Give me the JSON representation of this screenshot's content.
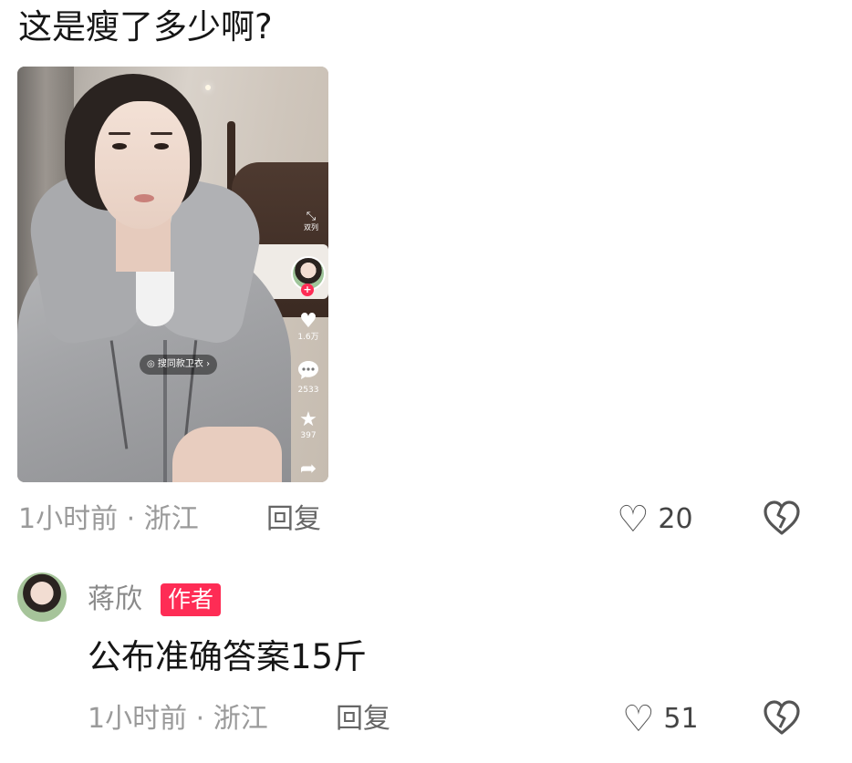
{
  "question": {
    "text": "这是瘦了多少啊?"
  },
  "video": {
    "collapse_label": "双列",
    "follow_plus": "+",
    "likes": "1.6万",
    "comments": "2533",
    "favorites": "397",
    "search_chip": "◎ 搜同款卫衣 ›"
  },
  "comment1": {
    "time_location": "1小时前 · 浙江",
    "reply_label": "回复",
    "like_count": "20"
  },
  "comment2": {
    "username": "蒋欣",
    "badge": "作者",
    "text": "公布准确答案15斤",
    "time_location": "1小时前 · 浙江",
    "reply_label": "回复",
    "like_count": "51"
  },
  "colors": {
    "accent": "#fe2c55",
    "meta_text": "#9a9a9a"
  },
  "icons": [
    "collapse-icon",
    "heart-icon",
    "comment-icon",
    "star-icon",
    "share-icon",
    "broken-heart-icon"
  ]
}
